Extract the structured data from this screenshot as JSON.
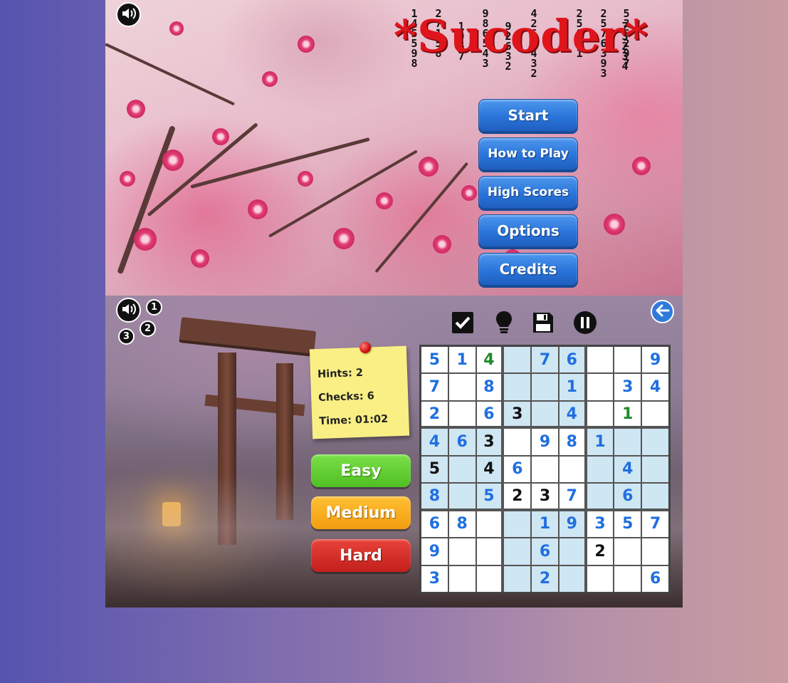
{
  "menu_screen": {
    "logo": "*Sucoder*",
    "logo_digit_columns": [
      "145598",
      "27158",
      "1967",
      "986543",
      "92632",
      "4267432",
      "25811",
      "2576393",
      "73234",
      "536297"
    ],
    "buttons": [
      "Start",
      "How to Play",
      "High Scores",
      "Options",
      "Credits"
    ]
  },
  "game_screen": {
    "level_badges": [
      "1",
      "2",
      "3"
    ],
    "stats": {
      "hints": "Hints: 2",
      "checks": "Checks: 6",
      "time": "Time: 01:02"
    },
    "difficulty": {
      "easy": "Easy",
      "medium": "Medium",
      "hard": "Hard"
    },
    "toolbar_icons": [
      "check-icon",
      "hint-bulb-icon",
      "save-icon",
      "pause-icon"
    ],
    "board": [
      [
        "5",
        "1",
        "4",
        "",
        "7",
        "6",
        "",
        "",
        "9"
      ],
      [
        "7",
        "",
        "8",
        "",
        "",
        "1",
        "",
        "3",
        "4"
      ],
      [
        "2",
        "",
        "6",
        "3",
        "",
        "4",
        "",
        "1",
        ""
      ],
      [
        "4",
        "6",
        "3",
        "",
        "9",
        "8",
        "1",
        "",
        ""
      ],
      [
        "5",
        "",
        "4",
        "6",
        "",
        "",
        "",
        "4",
        ""
      ],
      [
        "8",
        "",
        "5",
        "2",
        "3",
        "7",
        "",
        "6",
        ""
      ],
      [
        "6",
        "8",
        "",
        "",
        "1",
        "9",
        "3",
        "5",
        "7"
      ],
      [
        "9",
        "",
        "",
        "",
        "6",
        "",
        "2",
        "",
        ""
      ],
      [
        "3",
        "",
        "",
        "",
        "2",
        "",
        "",
        "",
        "6"
      ]
    ],
    "board_colors": [
      [
        "b",
        "b",
        "g",
        "",
        "b",
        "b",
        "",
        "",
        "b"
      ],
      [
        "b",
        "",
        "b",
        "",
        "",
        "b",
        "",
        "b",
        "b"
      ],
      [
        "b",
        "",
        "b",
        "k",
        "",
        "b",
        "",
        "g",
        ""
      ],
      [
        "b",
        "b",
        "k",
        "",
        "b",
        "b",
        "b",
        "",
        ""
      ],
      [
        "k",
        "",
        "k",
        "b",
        "",
        "",
        "",
        "b",
        ""
      ],
      [
        "b",
        "",
        "b",
        "k",
        "k",
        "b",
        "",
        "b",
        ""
      ],
      [
        "b",
        "b",
        "",
        "",
        "b",
        "b",
        "b",
        "b",
        "b"
      ],
      [
        "b",
        "",
        "",
        "",
        "b",
        "",
        "k",
        "",
        ""
      ],
      [
        "b",
        "",
        "",
        "",
        "b",
        "",
        "",
        "",
        "b"
      ]
    ],
    "colors": {
      "given_blue": "#1f6fe0",
      "entered_black": "#111111",
      "correct_green": "#1f8a2c",
      "box_shade": "#cfe6f3"
    }
  }
}
